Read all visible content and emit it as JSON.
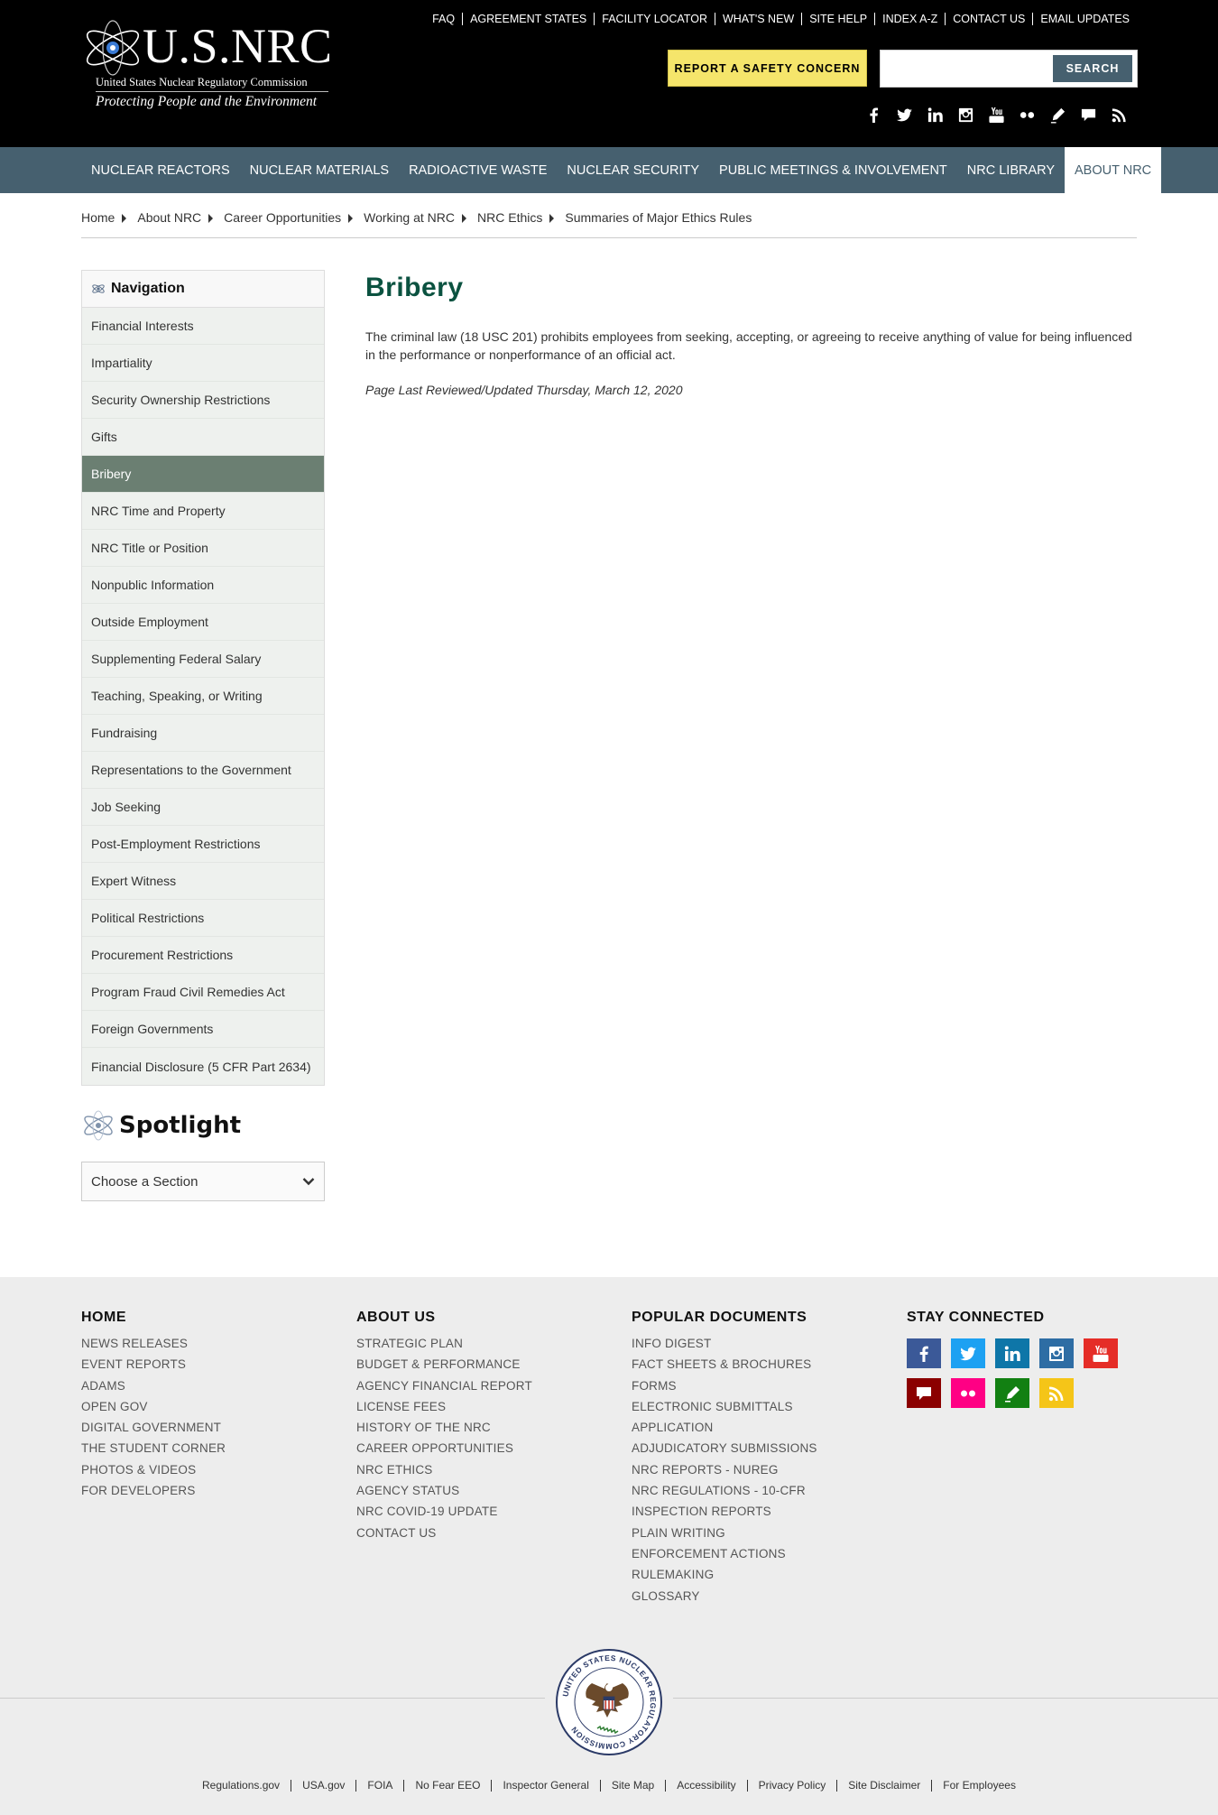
{
  "header": {
    "logo_usnrc": "U.S.NRC",
    "logo_fullname": "United States Nuclear Regulatory Commission",
    "logo_tagline": "Protecting People and the Environment",
    "utility_links": [
      "FAQ",
      "AGREEMENT STATES",
      "FACILITY LOCATOR",
      "WHAT'S NEW",
      "SITE HELP",
      "INDEX A-Z",
      "CONTACT US",
      "EMAIL UPDATES"
    ],
    "report_button": "REPORT A SAFETY CONCERN",
    "search_placeholder": "",
    "search_button": "SEARCH",
    "social_icons": [
      "facebook-icon",
      "twitter-icon",
      "linkedin-icon",
      "instagram-icon",
      "youtube-icon",
      "flickr-icon",
      "blog-pen-icon",
      "comment-icon",
      "rss-icon"
    ]
  },
  "main_nav": {
    "items": [
      "NUCLEAR REACTORS",
      "NUCLEAR MATERIALS",
      "RADIOACTIVE WASTE",
      "NUCLEAR SECURITY",
      "PUBLIC MEETINGS & INVOLVEMENT",
      "NRC LIBRARY",
      "ABOUT NRC"
    ],
    "active": "ABOUT NRC"
  },
  "breadcrumb": [
    "Home",
    "About NRC",
    "Career Opportunities",
    "Working at NRC",
    "NRC Ethics",
    "Summaries of Major Ethics Rules"
  ],
  "sidebar": {
    "nav_title": "Navigation",
    "items": [
      "Financial Interests",
      "Impartiality",
      "Security Ownership Restrictions",
      "Gifts",
      "Bribery",
      "NRC Time and Property",
      "NRC Title or Position",
      "Nonpublic Information",
      "Outside Employment",
      "Supplementing Federal Salary",
      "Teaching, Speaking, or Writing",
      "Fundraising",
      "Representations to the Government",
      "Job Seeking",
      "Post-Employment Restrictions",
      "Expert Witness",
      "Political Restrictions",
      "Procurement Restrictions",
      "Program Fraud Civil Remedies Act",
      "Foreign Governments",
      "Financial Disclosure (5 CFR Part 2634)"
    ],
    "active_item": "Bribery",
    "spotlight_title": "Spotlight",
    "section_select": "Choose a Section"
  },
  "content": {
    "title": "Bribery",
    "body": "The criminal law (18 USC 201) prohibits employees from seeking, accepting, or agreeing to receive anything of value for being influenced in the performance or nonperformance of an official act.",
    "updated": "Page Last Reviewed/Updated Thursday, March 12, 2020"
  },
  "footer": {
    "col1": {
      "heading": "HOME",
      "links": [
        "NEWS RELEASES",
        "EVENT REPORTS",
        "ADAMS",
        "OPEN GOV",
        "DIGITAL GOVERNMENT",
        "THE STUDENT CORNER",
        "PHOTOS & VIDEOS",
        "FOR DEVELOPERS"
      ]
    },
    "col2": {
      "heading": "ABOUT US",
      "links": [
        "STRATEGIC PLAN",
        "BUDGET & PERFORMANCE",
        "AGENCY FINANCIAL REPORT",
        "LICENSE FEES",
        "HISTORY OF THE NRC",
        "CAREER OPPORTUNITIES",
        "NRC ETHICS",
        "AGENCY STATUS",
        "NRC COVID-19 UPDATE",
        "CONTACT US"
      ]
    },
    "col3": {
      "heading": "POPULAR DOCUMENTS",
      "links": [
        "INFO DIGEST",
        "FACT SHEETS & BROCHURES",
        "FORMS",
        "ELECTRONIC SUBMITTALS",
        "APPLICATION",
        "ADJUDICATORY SUBMISSIONS",
        "NRC REPORTS - NUREG",
        "NRC REGULATIONS - 10-CFR",
        "INSPECTION REPORTS",
        "PLAIN WRITING",
        "ENFORCEMENT ACTIONS",
        "RULEMAKING",
        "GLOSSARY"
      ]
    },
    "col4": {
      "heading": "STAY CONNECTED"
    },
    "social_colors": {
      "facebook": "#3b5998",
      "twitter": "#1da1f2",
      "linkedin": "#0e76a8",
      "instagram": "#2e6da4",
      "youtube": "#e52d27",
      "comment": "#8b0000",
      "flickr": "#ff0084",
      "blog": "#128012",
      "rss": "#f5c518"
    },
    "seal_text": "UNITED STATES NUCLEAR REGULATORY COMMISSION",
    "bottom_links": [
      "Regulations.gov",
      "USA.gov",
      "FOIA",
      "No Fear EEO",
      "Inspector General",
      "Site Map",
      "Accessibility",
      "Privacy Policy",
      "Site Disclaimer",
      "For Employees"
    ]
  }
}
